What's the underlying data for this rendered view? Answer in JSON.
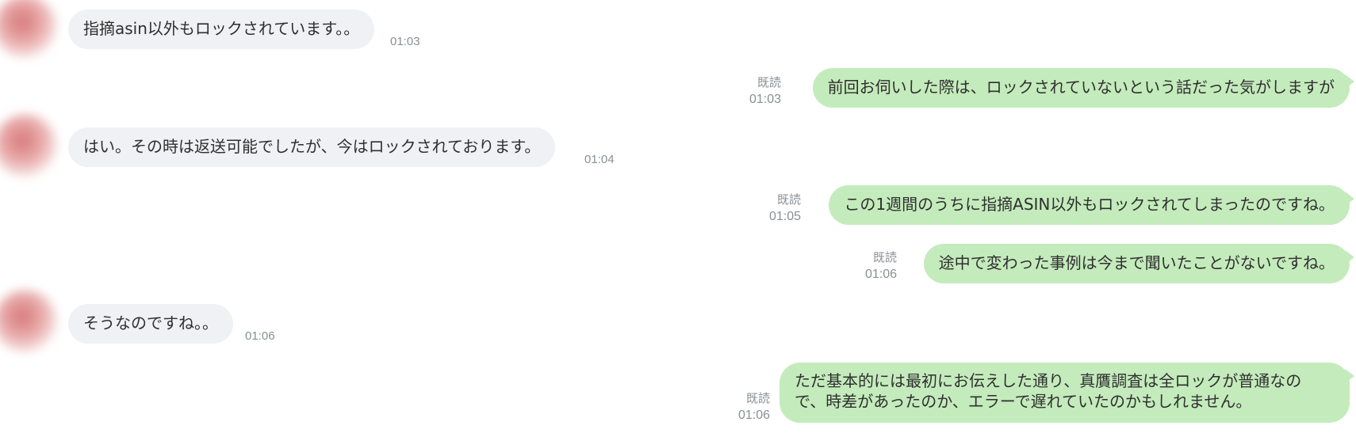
{
  "messages": [
    {
      "side": "incoming",
      "text": "指摘asin以外もロックされています。。",
      "time": "01:03"
    },
    {
      "side": "outgoing",
      "read": "既読",
      "text": "前回お伺いした際は、ロックされていないという話だった気がしますが",
      "time": "01:03"
    },
    {
      "side": "incoming",
      "text": "はい。その時は返送可能でしたが、今はロックされております。",
      "time": "01:04"
    },
    {
      "side": "outgoing",
      "read": "既読",
      "text": "この1週間のうちに指摘ASIN以外もロックされてしまったのですね。",
      "time": "01:05"
    },
    {
      "side": "outgoing",
      "read": "既読",
      "text": "途中で変わった事例は今まで聞いたことがないですね。",
      "time": "01:06"
    },
    {
      "side": "incoming",
      "text": "そうなのですね。。",
      "time": "01:06"
    },
    {
      "side": "outgoing",
      "read": "既読",
      "text_line1": "ただ基本的には最初にお伝えした通り、真贋調査は全ロックが普通なの",
      "text_line2": "で、時差があったのか、エラーで遅れていたのかもしれません。",
      "time": "01:06"
    }
  ],
  "colors": {
    "incoming_bubble": "#f0f1f4",
    "outgoing_bubble": "#c4ebbc",
    "meta_text": "#8a8f94"
  },
  "icons": {
    "avatar": "blurred-avatar"
  }
}
